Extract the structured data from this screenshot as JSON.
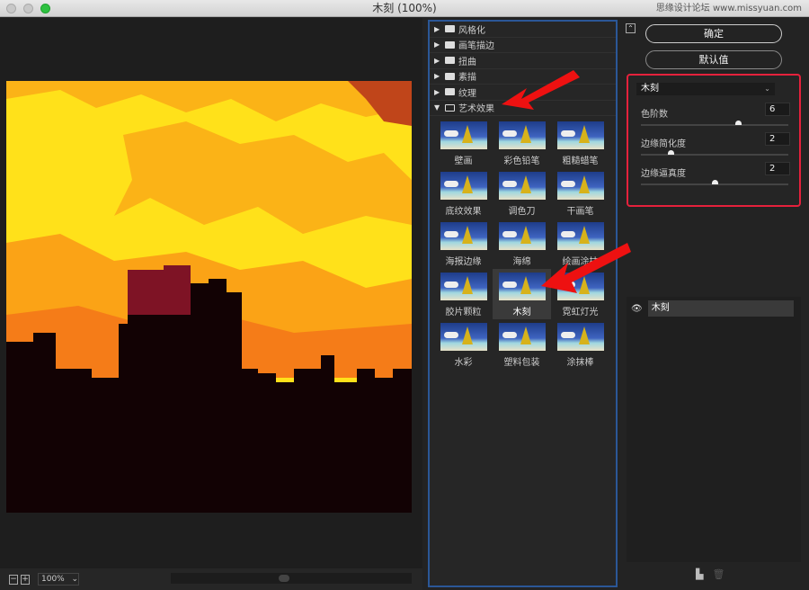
{
  "window": {
    "title": "木刻 (100%)",
    "watermark": "思缘设计论坛 www.missyuan.com"
  },
  "preview": {
    "zoom": "100%"
  },
  "gallery": {
    "categories": [
      {
        "label": "风格化",
        "open": false
      },
      {
        "label": "画笔描边",
        "open": false
      },
      {
        "label": "扭曲",
        "open": false
      },
      {
        "label": "素描",
        "open": false
      },
      {
        "label": "纹理",
        "open": false
      },
      {
        "label": "艺术效果",
        "open": true
      }
    ],
    "filters": [
      "壁画",
      "彩色铅笔",
      "粗糙蜡笔",
      "底纹效果",
      "调色刀",
      "干画笔",
      "海报边缘",
      "海绵",
      "绘画涂抹",
      "胶片颗粒",
      "木刻",
      "霓虹灯光",
      "水彩",
      "塑料包装",
      "涂抹棒"
    ],
    "selected": "木刻"
  },
  "buttons": {
    "ok": "确定",
    "default": "默认值"
  },
  "settings": {
    "filter": "木刻",
    "params": [
      {
        "label": "色阶数",
        "value": "6",
        "fraction": 0.66
      },
      {
        "label": "边缘简化度",
        "value": "2",
        "fraction": 0.2
      },
      {
        "label": "边缘逼真度",
        "value": "2",
        "fraction": 0.5
      }
    ]
  },
  "layers": [
    {
      "name": "木刻",
      "visible": true
    }
  ],
  "colors": {
    "highlight": "#e5213c",
    "panel_border": "#2b5797",
    "arrow": "#ee1111"
  }
}
